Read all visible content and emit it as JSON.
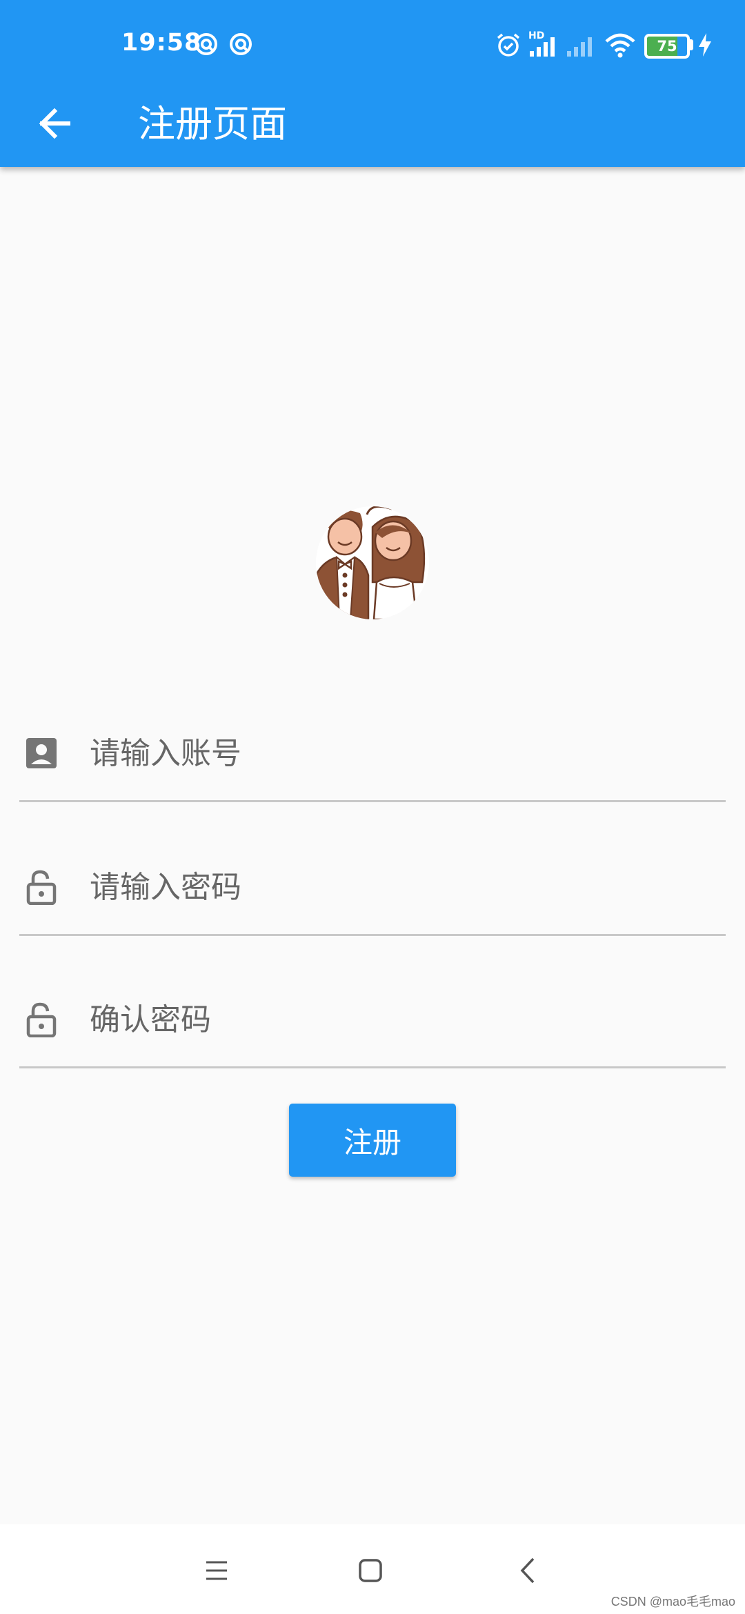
{
  "status_bar": {
    "time": "19:58",
    "network_label": "HD",
    "battery_level": "75",
    "battery_fraction": 0.75,
    "icons": [
      "sync-icon",
      "sync-icon",
      "alarm-icon",
      "signal-icon",
      "signal-icon",
      "wifi-icon",
      "battery-icon",
      "charging-icon"
    ]
  },
  "app_bar": {
    "title": "注册页面",
    "back_icon": "arrow-back-icon",
    "color": "#2196f3"
  },
  "avatar": {
    "icon": "couple-avatar-image"
  },
  "form": {
    "account_placeholder": "请输入账号",
    "account_value": "",
    "password_placeholder": "请输入密码",
    "password_value": "",
    "confirm_placeholder": "确认密码",
    "confirm_value": "",
    "account_icon": "contact-card-icon",
    "password_icon": "lock-open-icon",
    "confirm_icon": "lock-open-icon"
  },
  "submit": {
    "label": "注册"
  },
  "nav_bar": {
    "icons": [
      "menu-icon",
      "home-square-icon",
      "back-chevron-icon"
    ]
  },
  "watermark": "CSDN @mao毛毛mao"
}
